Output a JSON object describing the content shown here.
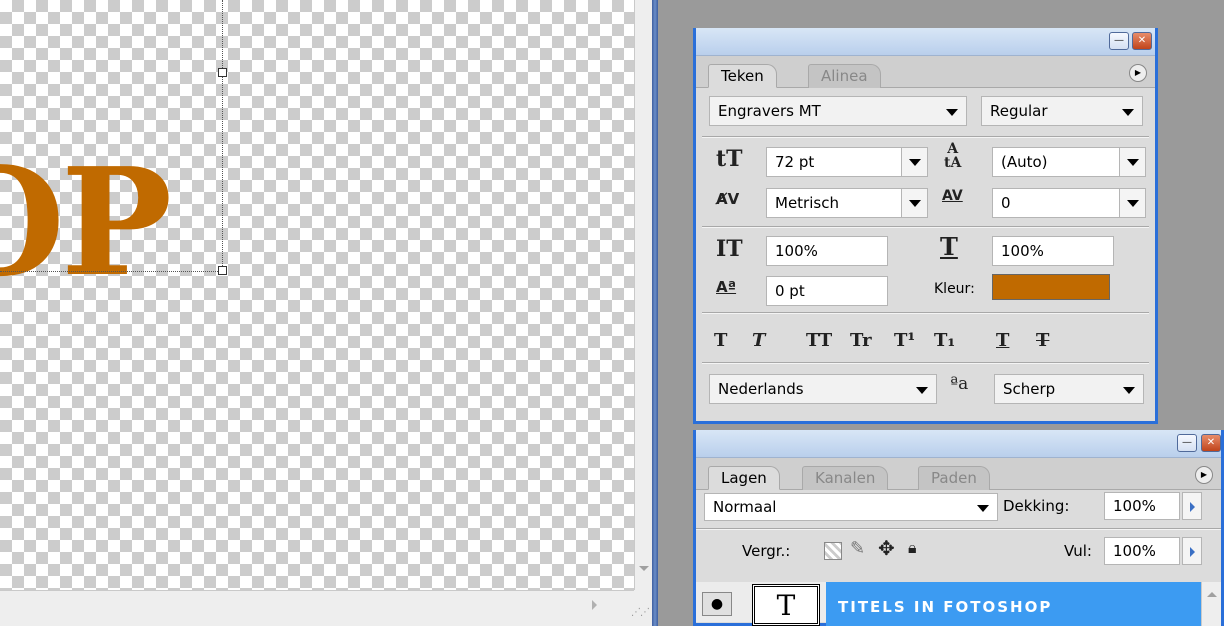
{
  "canvas": {
    "text": "OP"
  },
  "character_panel": {
    "tabs": [
      {
        "label": "Teken",
        "active": true
      },
      {
        "label": "Alinea",
        "active": false
      }
    ],
    "font_family": "Engravers MT",
    "font_style": "Regular",
    "font_size": "72 pt",
    "leading": "(Auto)",
    "kerning": "Metrisch",
    "tracking": "0",
    "vertical_scale": "100%",
    "horizontal_scale": "100%",
    "baseline_shift": "0 pt",
    "color_label": "Kleur:",
    "color": "#c06a00",
    "style_buttons": [
      "T",
      "T",
      "TT",
      "Tr",
      "T¹",
      "T₁",
      "T",
      "T"
    ],
    "language": "Nederlands",
    "antialias_icon_text": "ªa",
    "antialias": "Scherp"
  },
  "layers_panel": {
    "tabs": [
      {
        "label": "Lagen",
        "active": true
      },
      {
        "label": "Kanalen",
        "active": false
      },
      {
        "label": "Paden",
        "active": false
      }
    ],
    "blend_mode": "Normaal",
    "opacity_label": "Dekking:",
    "opacity": "100%",
    "lock_label": "Vergr.:",
    "fill_label": "Vul:",
    "fill": "100%",
    "layer": {
      "thumb": "T",
      "name": "TITELS IN FOTOSHOP"
    }
  },
  "window_buttons": {
    "minimize": "—",
    "close": "✕"
  }
}
